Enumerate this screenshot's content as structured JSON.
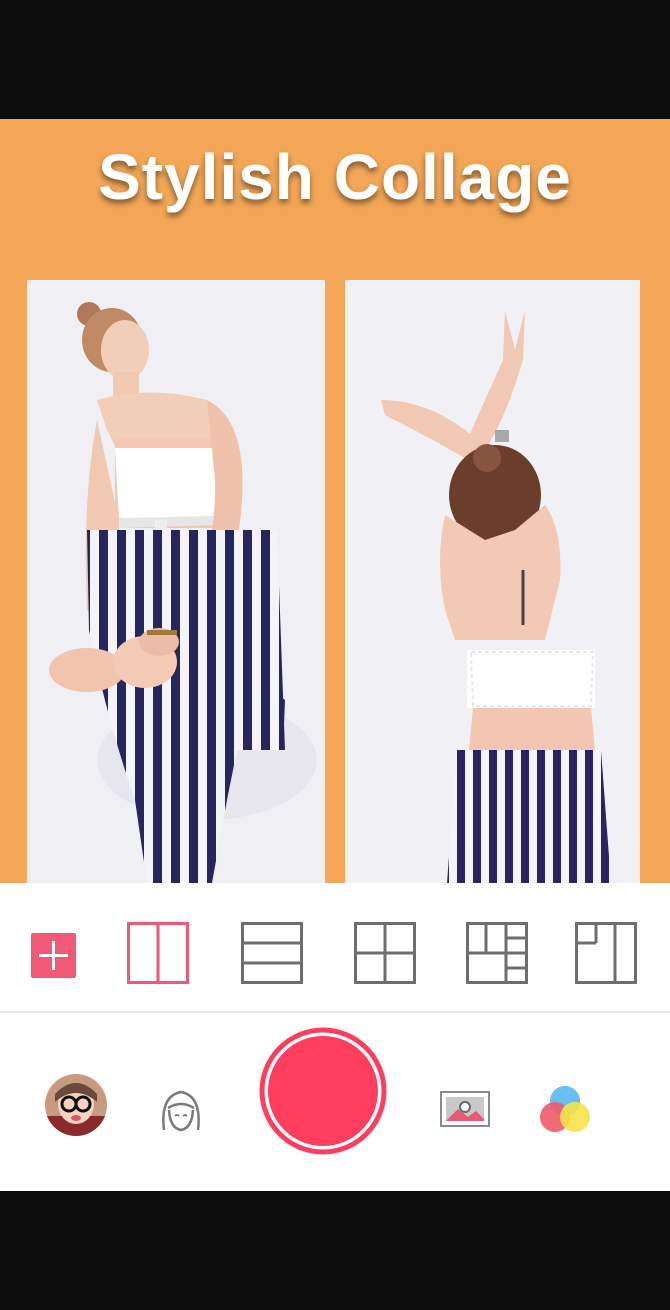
{
  "banner": {
    "headline": "Stylish Collage"
  },
  "collage": {
    "photos": [
      "photo-left",
      "photo-right"
    ]
  },
  "layouts": {
    "items": [
      {
        "name": "add-layout",
        "icon": "plus-icon",
        "selected": false
      },
      {
        "name": "layout-two-columns",
        "icon": "two-columns-icon",
        "selected": true
      },
      {
        "name": "layout-three-rows",
        "icon": "three-rows-icon",
        "selected": false
      },
      {
        "name": "layout-quad-grid",
        "icon": "quad-grid-icon",
        "selected": false
      },
      {
        "name": "layout-five-grid",
        "icon": "five-grid-icon",
        "selected": false
      },
      {
        "name": "layout-three-split",
        "icon": "three-split-icon",
        "selected": false
      }
    ],
    "accent_color": "#f15a77",
    "inactive_color": "#6e6e6e"
  },
  "toolbar": {
    "items": [
      "avatar-thumbnail",
      "face-beauty-icon",
      "capture-button",
      "camera-frame-icon",
      "color-filter-icon"
    ],
    "capture_color": "#ff3d5f"
  },
  "theme": {
    "banner_color": "#f2a656"
  }
}
